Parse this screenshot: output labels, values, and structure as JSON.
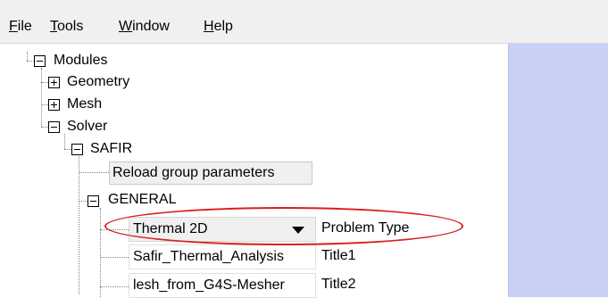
{
  "menu": {
    "items": [
      {
        "underline": "F",
        "rest": "ile"
      },
      {
        "underline": "T",
        "rest": "ools"
      },
      {
        "underline": "W",
        "rest": "indow"
      },
      {
        "underline": "H",
        "rest": "elp"
      }
    ]
  },
  "tree": {
    "modules": "Modules",
    "geometry": "Geometry",
    "mesh": "Mesh",
    "solver": "Solver",
    "safir": "SAFIR",
    "reload_button": "Reload group parameters",
    "general": "GENERAL",
    "params": [
      {
        "value": "Thermal 2D",
        "label": "Problem Type"
      },
      {
        "value": "Safir_Thermal_Analysis",
        "label": "Title1"
      },
      {
        "value": "lesh_from_G4S-Mesher",
        "label": "Title2"
      }
    ]
  },
  "colors": {
    "annotation_ellipse": "#d91f1f",
    "right_panel": "#c9d0f5"
  }
}
